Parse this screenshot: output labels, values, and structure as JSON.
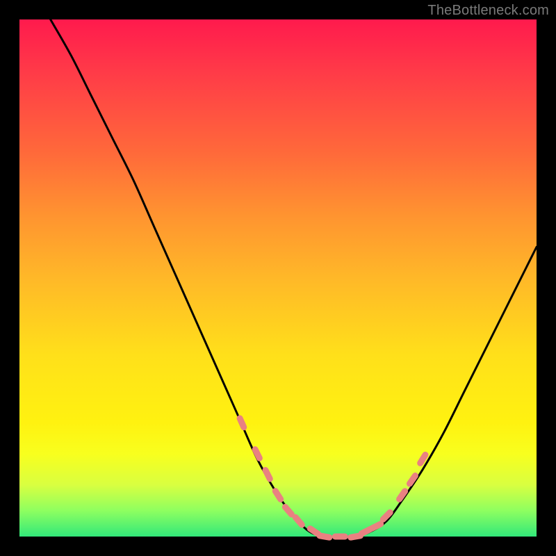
{
  "watermark": "TheBottleneck.com",
  "colors": {
    "frame": "#000000",
    "gradient_top": "#ff1a4d",
    "gradient_bottom": "#32e87a",
    "curve": "#000000",
    "marker": "#e98181"
  },
  "chart_data": {
    "type": "line",
    "title": "",
    "xlabel": "",
    "ylabel": "",
    "xlim": [
      0,
      100
    ],
    "ylim": [
      0,
      100
    ],
    "series": [
      {
        "name": "bottleneck-curve",
        "x": [
          6,
          10,
          14,
          18,
          22,
          26,
          30,
          34,
          38,
          42,
          46,
          50,
          53,
          56,
          59,
          62,
          65,
          68,
          71,
          74,
          78,
          82,
          86,
          90,
          94,
          98,
          100
        ],
        "values": [
          100,
          93,
          85,
          77,
          69,
          60,
          51,
          42,
          33,
          24,
          15,
          8,
          4,
          1,
          0,
          0,
          0,
          1,
          3,
          7,
          13,
          20,
          28,
          36,
          44,
          52,
          56
        ]
      }
    ],
    "markers": {
      "name": "highlight-band",
      "x": [
        43,
        46,
        48,
        50,
        52,
        54,
        57,
        59,
        62,
        65,
        67,
        69,
        71,
        74,
        76,
        78
      ],
      "values": [
        22,
        16,
        12,
        8,
        5,
        3,
        1,
        0,
        0,
        0,
        1,
        2,
        4,
        8,
        11,
        15
      ]
    }
  }
}
